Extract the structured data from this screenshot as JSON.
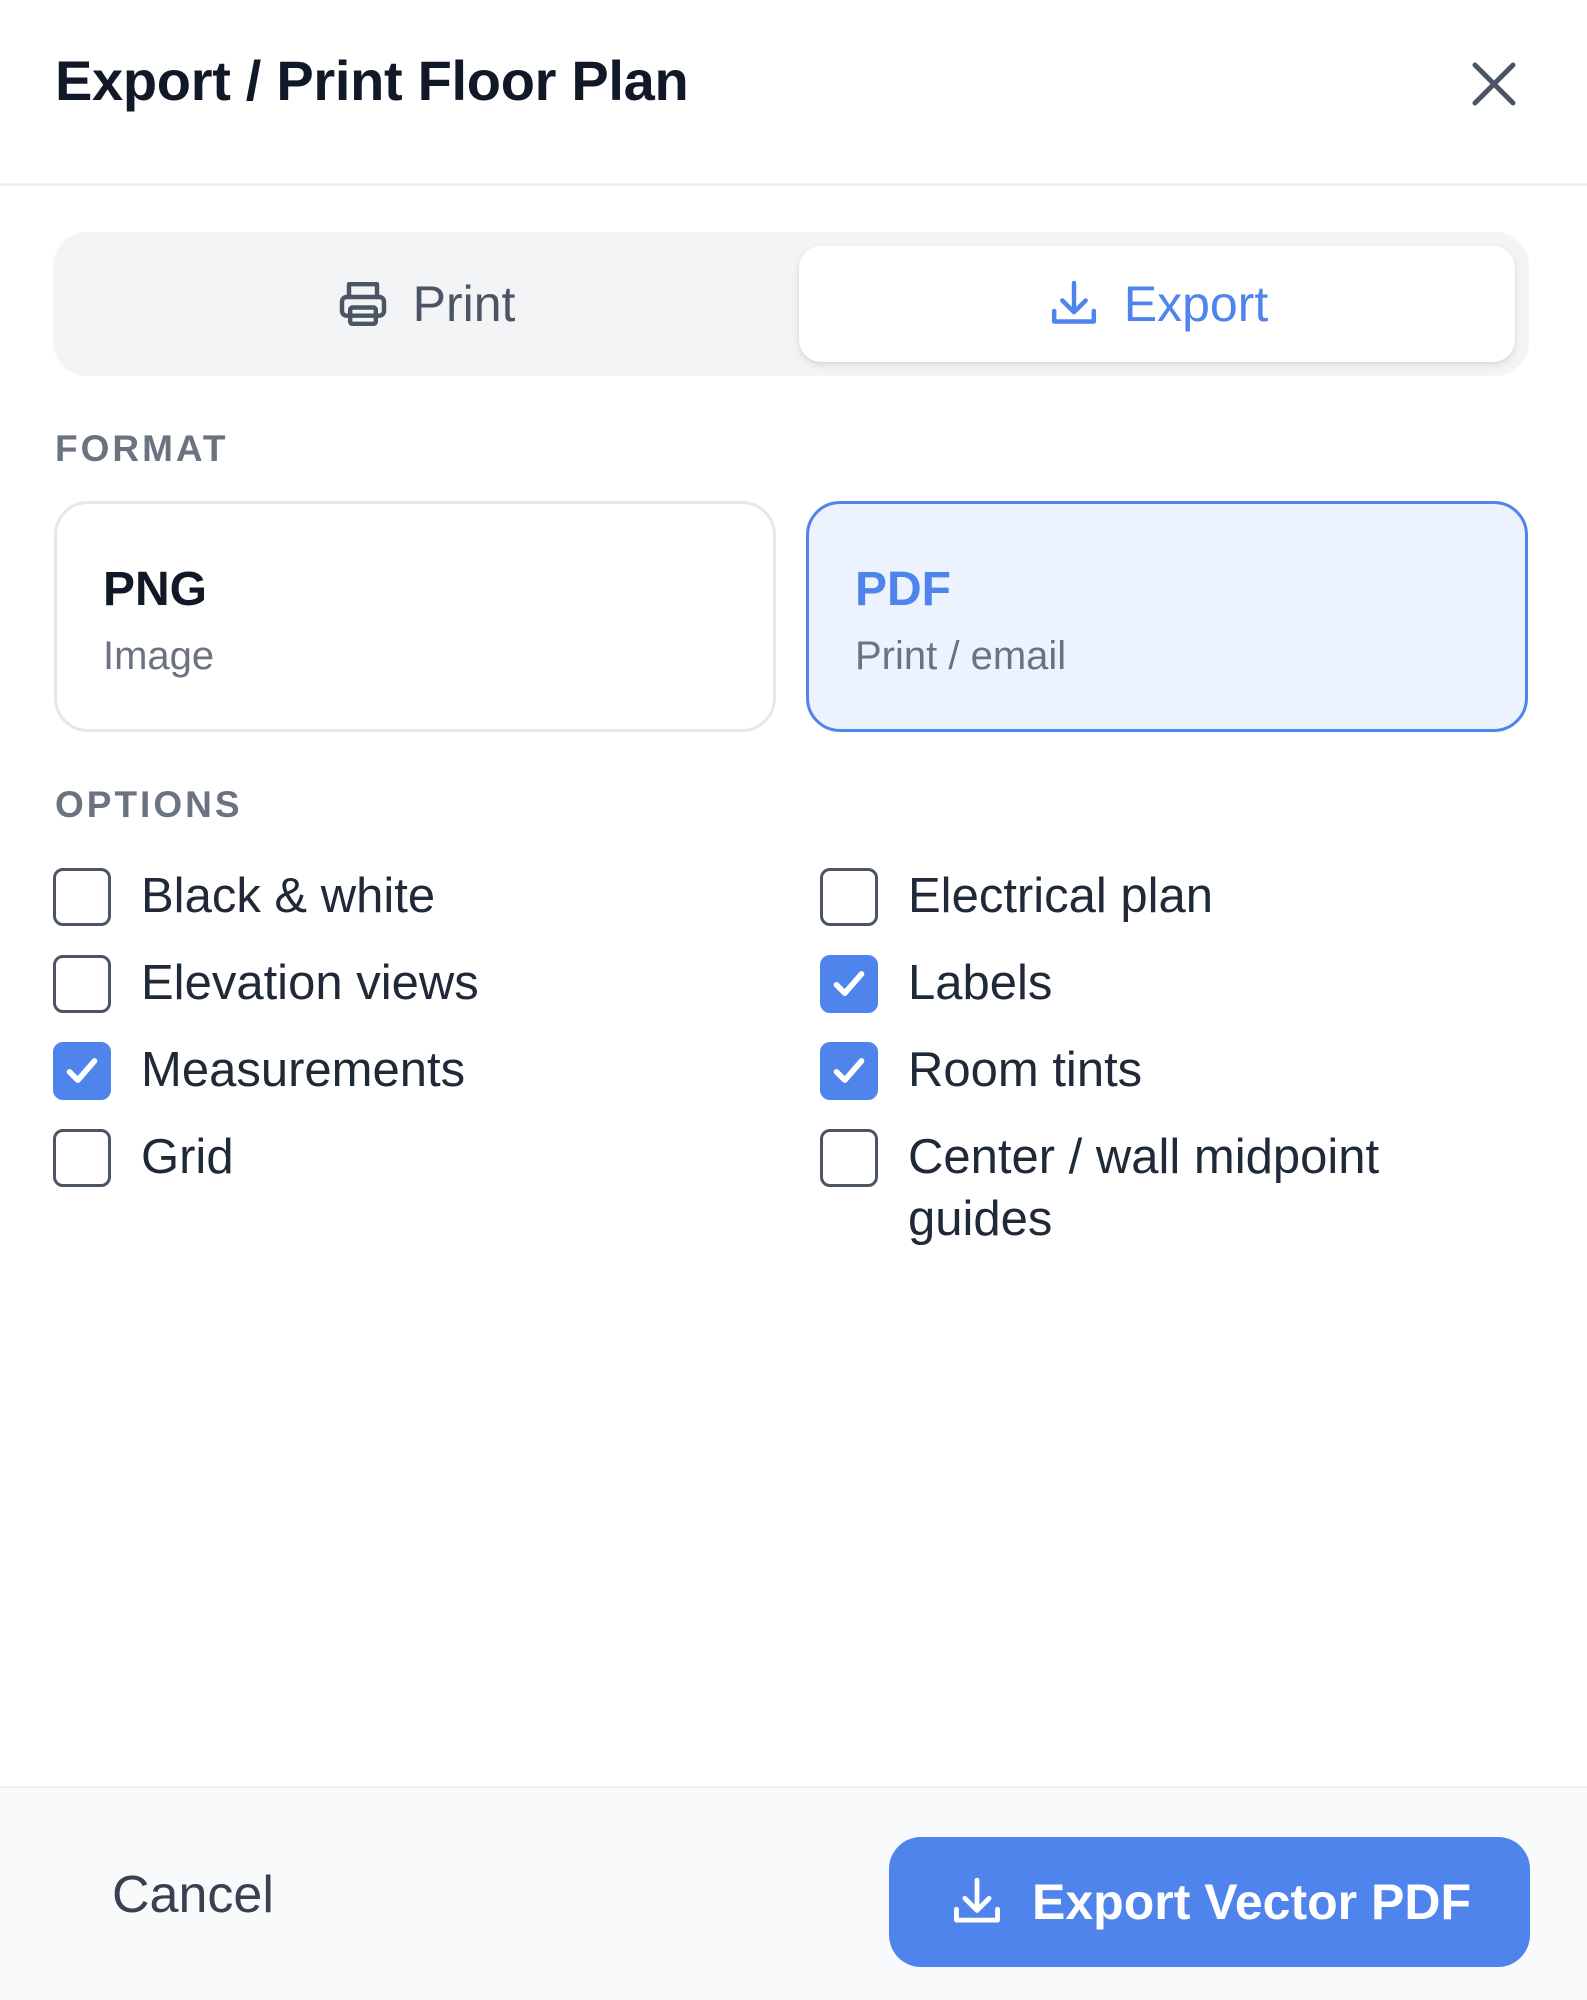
{
  "dialog": {
    "title": "Export / Print Floor Plan",
    "close_icon": "close-icon"
  },
  "tabs": [
    {
      "label": "Print",
      "icon": "printer-icon",
      "active": false
    },
    {
      "label": "Export",
      "icon": "download-icon",
      "active": true
    }
  ],
  "format": {
    "section_label": "FORMAT",
    "options": [
      {
        "title": "PNG",
        "subtitle": "Image",
        "selected": false
      },
      {
        "title": "PDF",
        "subtitle": "Print / email",
        "selected": true
      }
    ]
  },
  "options": {
    "section_label": "OPTIONS",
    "items": [
      {
        "label": "Black & white",
        "checked": false
      },
      {
        "label": "Electrical plan",
        "checked": false
      },
      {
        "label": "Elevation views",
        "checked": false
      },
      {
        "label": "Labels",
        "checked": true
      },
      {
        "label": "Measurements",
        "checked": true
      },
      {
        "label": "Room tints",
        "checked": true
      },
      {
        "label": "Grid",
        "checked": false
      },
      {
        "label": "Center / wall midpoint guides",
        "checked": false
      }
    ]
  },
  "footer": {
    "cancel_label": "Cancel",
    "primary_label": "Export Vector PDF",
    "primary_icon": "download-icon"
  },
  "colors": {
    "accent": "#4f84ec",
    "accent_light_bg": "#edf3fe",
    "title_text": "#111827",
    "muted_text": "#6b7280"
  }
}
